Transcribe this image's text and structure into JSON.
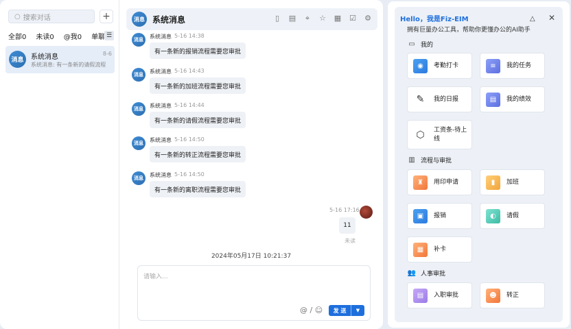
{
  "sidebar": {
    "search_placeholder": "搜索对话",
    "add_label": "+",
    "filters": [
      "全部0",
      "未读0",
      "@我0",
      "单聊0"
    ],
    "conversation": {
      "avatar_text": "消息",
      "title": "系统消息",
      "date": "8-6",
      "preview": "系统消息: 有一条新的请假流程"
    }
  },
  "chat": {
    "header": {
      "avatar_text": "消息",
      "title": "系统消息"
    },
    "messages": [
      {
        "avatar_text": "消息",
        "sender": "系统消息",
        "time": "5-16 14:38",
        "text": "有一条新的报销流程需要您审批"
      },
      {
        "avatar_text": "消息",
        "sender": "系统消息",
        "time": "5-16 14:43",
        "text": "有一条新的加班流程需要您审批"
      },
      {
        "avatar_text": "消息",
        "sender": "系统消息",
        "time": "5-16 14:44",
        "text": "有一条新的请假流程需要您审批"
      },
      {
        "avatar_text": "消息",
        "sender": "系统消息",
        "time": "5-16 14:50",
        "text": "有一条新的转正流程需要您审批"
      },
      {
        "avatar_text": "消息",
        "sender": "系统消息",
        "time": "5-16 14:50",
        "text": "有一条新的离职流程需要您审批"
      }
    ],
    "self_message": {
      "time": "5-16 17:16",
      "text": "11",
      "status": "未读"
    },
    "date_divider": "2024年05月17日 10:21:37",
    "composer": {
      "placeholder": "请输入...",
      "send_label": "发 送"
    }
  },
  "assistant": {
    "hello": "Hello，我是Fiz-EIM",
    "subtitle": "拥有巨量办公工具，帮助你更懂办公的AI助手",
    "sections": [
      {
        "title": "我的",
        "items": [
          "考勤打卡",
          "我的任务",
          "我的日报",
          "我的绩效",
          "工资条-待上线"
        ]
      },
      {
        "title": "流程与审批",
        "items": [
          "用印申请",
          "加班",
          "报销",
          "请假",
          "补卡"
        ]
      },
      {
        "title": "人事审批",
        "items": [
          "入职审批",
          "转正"
        ]
      }
    ]
  }
}
